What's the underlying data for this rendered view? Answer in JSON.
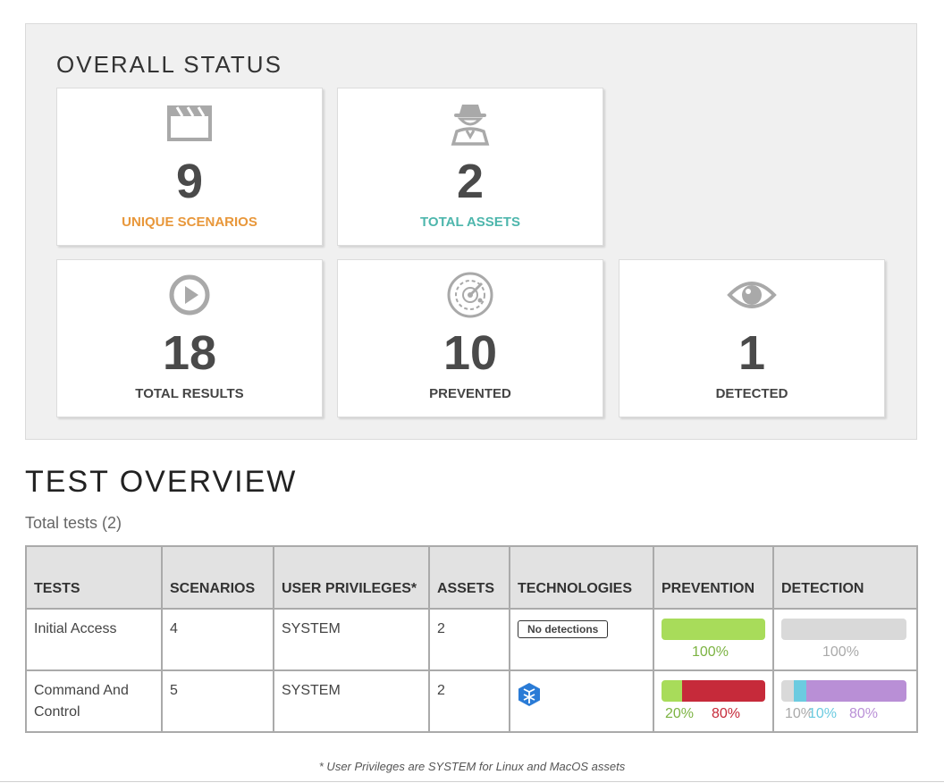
{
  "overall_status": {
    "title": "OVERALL STATUS",
    "cards": [
      {
        "value": "9",
        "label": "UNIQUE SCENARIOS",
        "icon": "clapperboard-icon",
        "label_color": "#e8973a"
      },
      {
        "value": "2",
        "label": "TOTAL ASSETS",
        "icon": "spy-agent-icon",
        "label_color": "#4db6ac"
      },
      {
        "value": "18",
        "label": "TOTAL RESULTS",
        "icon": "play-circle-icon",
        "label_color": "#444444"
      },
      {
        "value": "10",
        "label": "PREVENTED",
        "icon": "radar-icon",
        "label_color": "#444444"
      },
      {
        "value": "1",
        "label": "DETECTED",
        "icon": "eye-icon",
        "label_color": "#444444"
      }
    ]
  },
  "test_overview": {
    "title": "TEST OVERVIEW",
    "subtitle": "Total tests (2)",
    "columns": [
      "TESTS",
      "SCENARIOS",
      "USER PRIVILEGES*",
      "ASSETS",
      "TECHNOLOGIES",
      "PREVENTION",
      "DETECTION"
    ],
    "rows": [
      {
        "test": "Initial Access",
        "scenarios": "4",
        "privileges": "SYSTEM",
        "assets": "2",
        "technologies": "No detections",
        "technology_icon": "",
        "prevention": [
          {
            "pct": "100%",
            "value": 100,
            "color": "#a8dc5a",
            "text_color": "#7cb342"
          }
        ],
        "detection": [
          {
            "pct": "100%",
            "value": 100,
            "color": "#d9d9d9",
            "text_color": "#aaaaaa"
          }
        ]
      },
      {
        "test": "Command And Control",
        "scenarios": "5",
        "privileges": "SYSTEM",
        "assets": "2",
        "technologies": "",
        "technology_icon": "hexagon-logo-icon",
        "prevention": [
          {
            "pct": "20%",
            "value": 20,
            "color": "#a8dc5a",
            "text_color": "#7cb342"
          },
          {
            "pct": "80%",
            "value": 80,
            "color": "#c62a3a",
            "text_color": "#c62a3a"
          }
        ],
        "detection": [
          {
            "pct": "10%",
            "value": 10,
            "color": "#d9d9d9",
            "text_color": "#aaaaaa"
          },
          {
            "pct": "10%",
            "value": 10,
            "color": "#6ccbe0",
            "text_color": "#6ccbe0"
          },
          {
            "pct": "80%",
            "value": 80,
            "color": "#b98fd6",
            "text_color": "#b98fd6"
          }
        ]
      }
    ]
  },
  "footnote": "* User Privileges are SYSTEM for Linux and MacOS assets"
}
